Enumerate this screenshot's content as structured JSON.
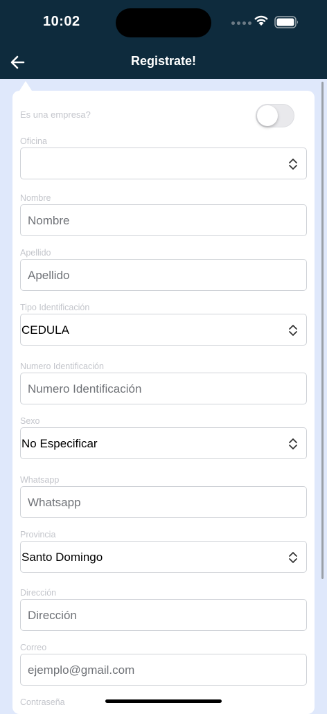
{
  "status_bar": {
    "time": "10:02"
  },
  "header": {
    "title": "Registrate!"
  },
  "form": {
    "company_toggle_label": "Es una empresa?",
    "company_toggle_on": false,
    "oficina": {
      "label": "Oficina",
      "value": ""
    },
    "nombre": {
      "label": "Nombre",
      "placeholder": "Nombre"
    },
    "apellido": {
      "label": "Apellido",
      "placeholder": "Apellido"
    },
    "tipo_identificacion": {
      "label": "Tipo Identificación",
      "value": "CEDULA"
    },
    "numero_identificacion": {
      "label": "Numero Identificación",
      "placeholder": "Numero Identificación"
    },
    "sexo": {
      "label": "Sexo",
      "value": "No Especificar"
    },
    "whatsapp": {
      "label": "Whatsapp",
      "placeholder": "Whatsapp"
    },
    "provincia": {
      "label": "Provincia",
      "value": "Santo Domingo"
    },
    "direccion": {
      "label": "Dirección",
      "placeholder": "Dirección"
    },
    "correo": {
      "label": "Correo",
      "placeholder": "ejemplo@gmail.com"
    },
    "contrasena": {
      "label": "Contraseña"
    }
  },
  "colors": {
    "header_bg": "#0e2b3d",
    "page_bg": "#dfe8fb",
    "card_bg": "#ffffff"
  }
}
